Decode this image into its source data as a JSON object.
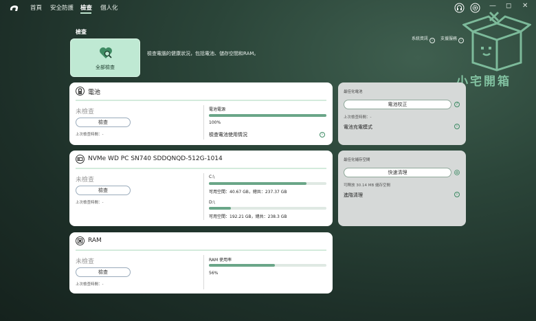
{
  "nav": {
    "home": "首頁",
    "security": "安全防護",
    "check": "檢查",
    "personal": "個人化"
  },
  "window": {
    "min": "—",
    "restore": "◻",
    "close": "✕"
  },
  "page": {
    "section_title": "檢查",
    "hero_label": "全部檢查",
    "hero_desc": "檢查電腦的健康狀況，包括電池、儲存空間和RAM。",
    "sysinfo_link": "系統資訊",
    "support_link": "支援服務"
  },
  "battery": {
    "title": "電池",
    "status": "未檢查",
    "check_btn": "檢查",
    "last_check": "上次檢查時間：-",
    "source_label": "電池電源",
    "source_value": "100%",
    "source_pct": 100,
    "usage_link": "檢查電池使用情況"
  },
  "storage": {
    "title": "NVMe WD PC SN740 SDDQNQD-512G-1014",
    "status": "未檢查",
    "check_btn": "檢查",
    "last_check": "上次檢查時間：-",
    "drive_c": {
      "label": "C:\\",
      "value": "可用空間：40.67 GB，總共：237.37 GB",
      "used_fraction": 0.83
    },
    "drive_d": {
      "label": "D:\\",
      "value": "可用空間：192.21 GB，總共：238.3 GB",
      "used_fraction": 0.19
    }
  },
  "ram": {
    "title": "RAM",
    "status": "未檢查",
    "check_btn": "檢查",
    "last_check": "上次檢查時間：-",
    "usage_label": "RAM 使用率",
    "usage_value": "56%",
    "usage_pct": 56
  },
  "side_battery": {
    "title": "最佳化電池",
    "button": "電池校正",
    "last_check": "上次檢查時間：-",
    "link": "電池充電模式"
  },
  "side_storage": {
    "title": "最佳化儲存空間",
    "button": "快速清理",
    "freeable": "可釋放 30.14 MB 儲存空間",
    "link": "進階清理"
  },
  "watermark": {
    "text": "小宅開箱"
  },
  "colors": {
    "accent": "#6aa688",
    "hero_bg": "#bfe9d3",
    "side_bg": "#d6d9d8"
  }
}
